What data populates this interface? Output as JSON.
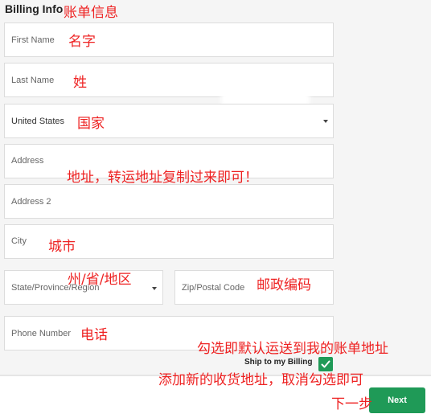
{
  "section": {
    "title": "Billing Info"
  },
  "fields": {
    "first_name": {
      "placeholder": "First Name"
    },
    "last_name": {
      "placeholder": "Last Name"
    },
    "country": {
      "value": "United States"
    },
    "address": {
      "placeholder": "Address"
    },
    "address2": {
      "placeholder": "Address 2"
    },
    "city": {
      "placeholder": "City"
    },
    "state": {
      "placeholder": "State/Province/Region"
    },
    "zip": {
      "placeholder": "Zip/Postal Code"
    },
    "phone": {
      "placeholder": "Phone Number"
    }
  },
  "ship_to_billing": {
    "label": "Ship to my Billing",
    "checked": true
  },
  "next_button": {
    "label": "Next"
  },
  "annotations": {
    "title": "账单信息",
    "first_name": "名字",
    "last_name": "姓",
    "country": "国家",
    "address": "地址，转运地址复制过来即可！",
    "city": "城市",
    "state": "州/省/地区",
    "zip": "邮政编码",
    "phone": "电话",
    "check_default": "勾选即默认运送到我的账单地址",
    "uncheck_new": "添加新的收货地址，取消勾选即可",
    "next": "下一步"
  },
  "colors": {
    "accent": "#1f9a57",
    "annotation": "#ee2222"
  }
}
